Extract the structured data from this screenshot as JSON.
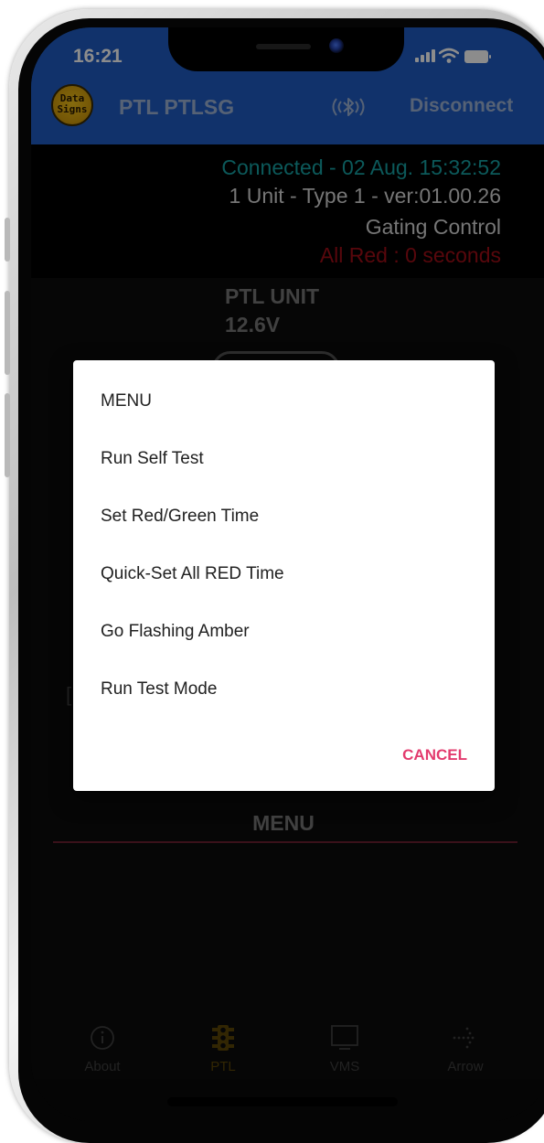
{
  "status_bar": {
    "time": "16:21"
  },
  "header": {
    "logo_text_line1": "Data",
    "logo_text_line2": "Signs",
    "title": "PTL PTLSG",
    "bluetooth_icon": "bluetooth-wave-icon",
    "disconnect_label": "Disconnect"
  },
  "info": {
    "connected": "Connected - 02 Aug. 15:32:52",
    "unit_details": "1 Unit - Type 1 - ver:01.00.26",
    "mode": "Gating Control",
    "all_red": "All Red : 0 seconds"
  },
  "unit": {
    "name": "PTL UNIT",
    "voltage": "12.6V"
  },
  "background_partial": {
    "bracket": "["
  },
  "menu_tab_label": "MENU",
  "dialog": {
    "title": "MENU",
    "items": [
      "Run Self Test",
      "Set Red/Green Time",
      "Quick-Set All RED Time",
      "Go Flashing Amber",
      "Run Test Mode"
    ],
    "cancel_label": "CANCEL"
  },
  "bottom_nav": [
    {
      "label": "About",
      "icon": "info-icon",
      "active": false
    },
    {
      "label": "PTL",
      "icon": "traffic-light-icon",
      "active": true
    },
    {
      "label": "VMS",
      "icon": "monitor-icon",
      "active": false
    },
    {
      "label": "Arrow",
      "icon": "arrow-dots-icon",
      "active": false
    }
  ],
  "colors": {
    "header_blue": "#1f5bc3",
    "connected_teal": "#16a2a4",
    "all_red": "#a10e17",
    "cancel_pink": "#e33b6e",
    "active_nav": "#5c4607"
  }
}
